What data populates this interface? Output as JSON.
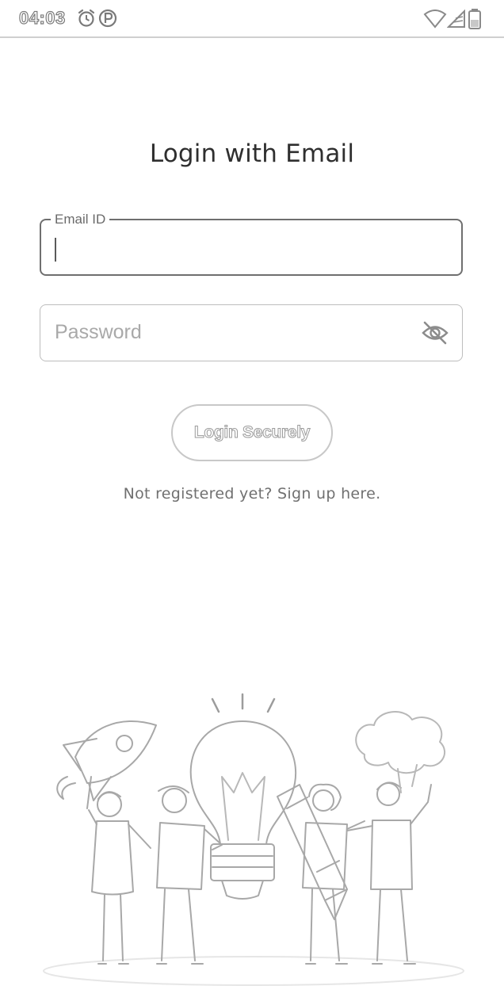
{
  "status_bar": {
    "time": "04:03",
    "icons": [
      "alarm-icon",
      "p-icon",
      "wifi-icon",
      "signal-icon",
      "battery-icon"
    ]
  },
  "login": {
    "title": "Login with Email",
    "email_label": "Email ID",
    "password_placeholder": "Password",
    "login_button": "Login Securely",
    "signup_text": "Not registered yet? Sign up here."
  },
  "illustration": {
    "name": "team-lightbulb-illustration"
  }
}
